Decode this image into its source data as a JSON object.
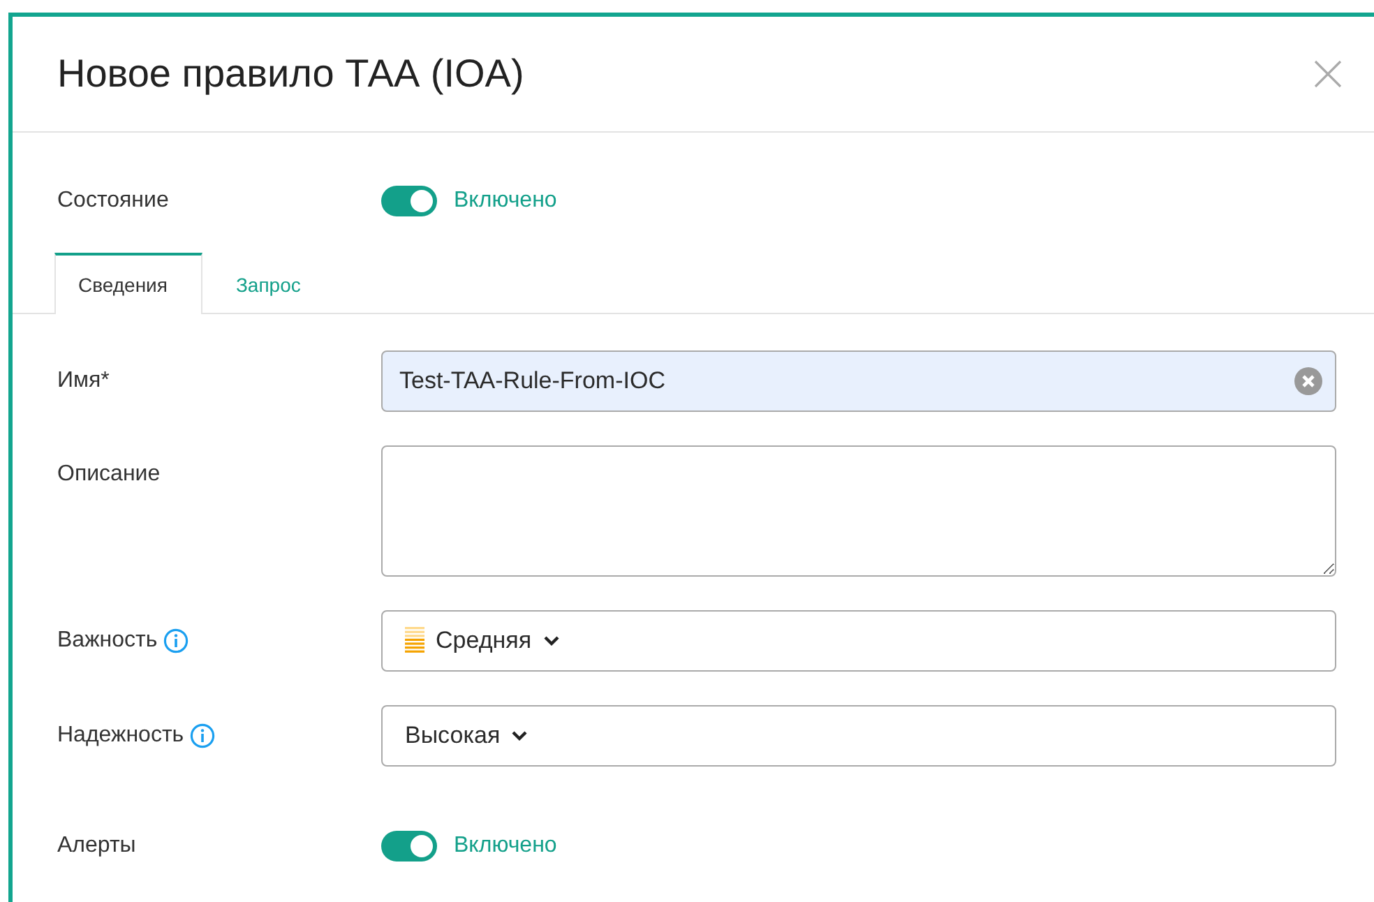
{
  "dialog": {
    "title": "Новое правило ТАА (IOA)"
  },
  "state": {
    "label": "Состояние",
    "on": true,
    "value_text": "Включено"
  },
  "tabs": [
    {
      "label": "Сведения",
      "selected": true
    },
    {
      "label": "Запрос",
      "selected": false
    }
  ],
  "fields": [
    {
      "kind": "text",
      "label": "Имя*",
      "value": "Test-TAA-Rule-From-IOC",
      "info": false
    },
    {
      "kind": "textarea",
      "label": "Описание",
      "info": false
    },
    {
      "kind": "select",
      "label": "Важность",
      "value": "Средняя",
      "info": true,
      "severity_icon": true
    },
    {
      "kind": "select",
      "label": "Надежность",
      "value": "Высокая",
      "info": true,
      "severity_icon": false
    },
    {
      "kind": "toggle",
      "label": "Алерты",
      "on": true,
      "value_text": "Включено",
      "info": false
    }
  ]
}
